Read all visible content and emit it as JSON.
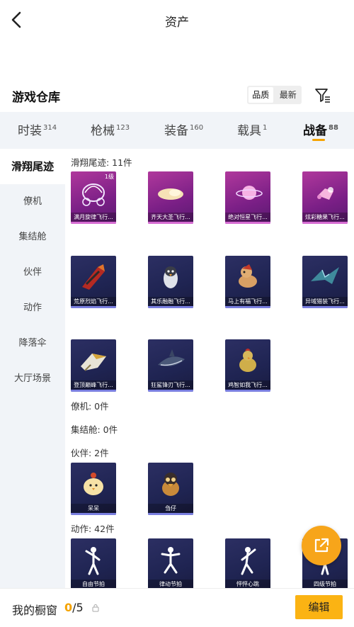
{
  "header": {
    "title": "资产"
  },
  "warehouse": {
    "title": "游戏仓库",
    "sort_options": [
      "品质",
      "最新"
    ]
  },
  "tabs": [
    {
      "label": "时装",
      "count": "314"
    },
    {
      "label": "枪械",
      "count": "123"
    },
    {
      "label": "装备",
      "count": "160"
    },
    {
      "label": "载具",
      "count": "1"
    },
    {
      "label": "战备",
      "count": "88"
    }
  ],
  "sidebar": {
    "items": [
      {
        "label": "滑翔尾迹"
      },
      {
        "label": "僚机"
      },
      {
        "label": "集结舱"
      },
      {
        "label": "伙伴"
      },
      {
        "label": "动作"
      },
      {
        "label": "降落伞"
      },
      {
        "label": "大厅场景"
      }
    ]
  },
  "sections": {
    "glide": {
      "title": "滑翔尾迹: 11件"
    },
    "wingman": {
      "title": "僚机: 0件"
    },
    "pod": {
      "title": "集结舱: 0件"
    },
    "partner": {
      "title": "伙伴: 2件"
    },
    "action": {
      "title": "动作: 42件"
    }
  },
  "glide_items": [
    {
      "name": "满月旋律飞行...",
      "level": "1级",
      "rarity": "pink",
      "icon": "carriage-icon"
    },
    {
      "name": "齐天大圣飞行...",
      "rarity": "pink",
      "icon": "cloud-icon"
    },
    {
      "name": "绝对恒星飞行...",
      "rarity": "pink",
      "icon": "planet-icon"
    },
    {
      "name": "炫彩糖果飞行...",
      "rarity": "pink",
      "icon": "candy-icon"
    },
    {
      "name": "荒原烈焰飞行...",
      "rarity": "blue",
      "icon": "flame-craft-icon"
    },
    {
      "name": "其乐融融飞行...",
      "rarity": "blue",
      "icon": "penguin-icon"
    },
    {
      "name": "马上有福飞行...",
      "rarity": "blue",
      "icon": "horse-icon"
    },
    {
      "name": "异域猎装飞行...",
      "rarity": "blue",
      "icon": "wing-icon"
    },
    {
      "name": "登顶巅峰飞行...",
      "rarity": "blue",
      "icon": "jet-icon"
    },
    {
      "name": "狂鲨锋刃飞行...",
      "rarity": "blue",
      "icon": "shark-icon"
    },
    {
      "name": "鸡智如我飞行...",
      "rarity": "blue",
      "icon": "chicken-icon"
    }
  ],
  "partner_items": [
    {
      "name": "呆呆",
      "rarity": "blue",
      "icon": "chick-icon"
    },
    {
      "name": "刍仔",
      "rarity": "blue",
      "icon": "duck-icon"
    }
  ],
  "action_items": [
    {
      "name": "自由节拍",
      "rarity": "blue",
      "icon": "dancer-icon"
    },
    {
      "name": "律动节拍",
      "rarity": "blue",
      "icon": "dancer-icon"
    },
    {
      "name": "怦怦心跳",
      "rarity": "blue",
      "icon": "dancer-icon"
    },
    {
      "name": "四级节拍",
      "rarity": "blue",
      "icon": "dancer-icon"
    }
  ],
  "bottom": {
    "label": "我的橱窗",
    "current": "0",
    "total": "/5",
    "edit_label": "编辑"
  },
  "colors": {
    "accent": "#f5a300",
    "edit_button": "#fbb313",
    "fab": "#f7a51a",
    "pink_rarity": "#9b2f93",
    "blue_rarity": "#24285a"
  }
}
